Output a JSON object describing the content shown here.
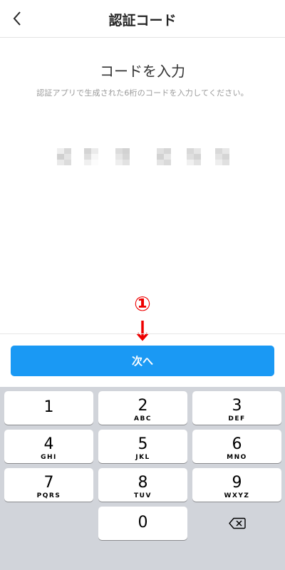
{
  "header": {
    "title": "認証コード",
    "back_icon": "chevron-left-icon"
  },
  "main": {
    "heading": "コードを入力",
    "description": "認証アプリで生成された6桁のコードを入力してください。",
    "code_digit_count": 6,
    "code_value": "blurred"
  },
  "annotation": {
    "marker": "①",
    "arrow_icon": "arrow-down-icon",
    "color": "#ee0000"
  },
  "next_button": {
    "label": "次へ",
    "color": "#1a99f4"
  },
  "keypad": {
    "keys": [
      {
        "num": "1",
        "letters": ""
      },
      {
        "num": "2",
        "letters": "ABC"
      },
      {
        "num": "3",
        "letters": "DEF"
      },
      {
        "num": "4",
        "letters": "GHI"
      },
      {
        "num": "5",
        "letters": "JKL"
      },
      {
        "num": "6",
        "letters": "MNO"
      },
      {
        "num": "7",
        "letters": "PQRS"
      },
      {
        "num": "8",
        "letters": "TUV"
      },
      {
        "num": "9",
        "letters": "WXYZ"
      },
      {
        "num": "0",
        "letters": ""
      }
    ],
    "delete_icon": "backspace-icon",
    "background_color": "#d1d4da"
  }
}
